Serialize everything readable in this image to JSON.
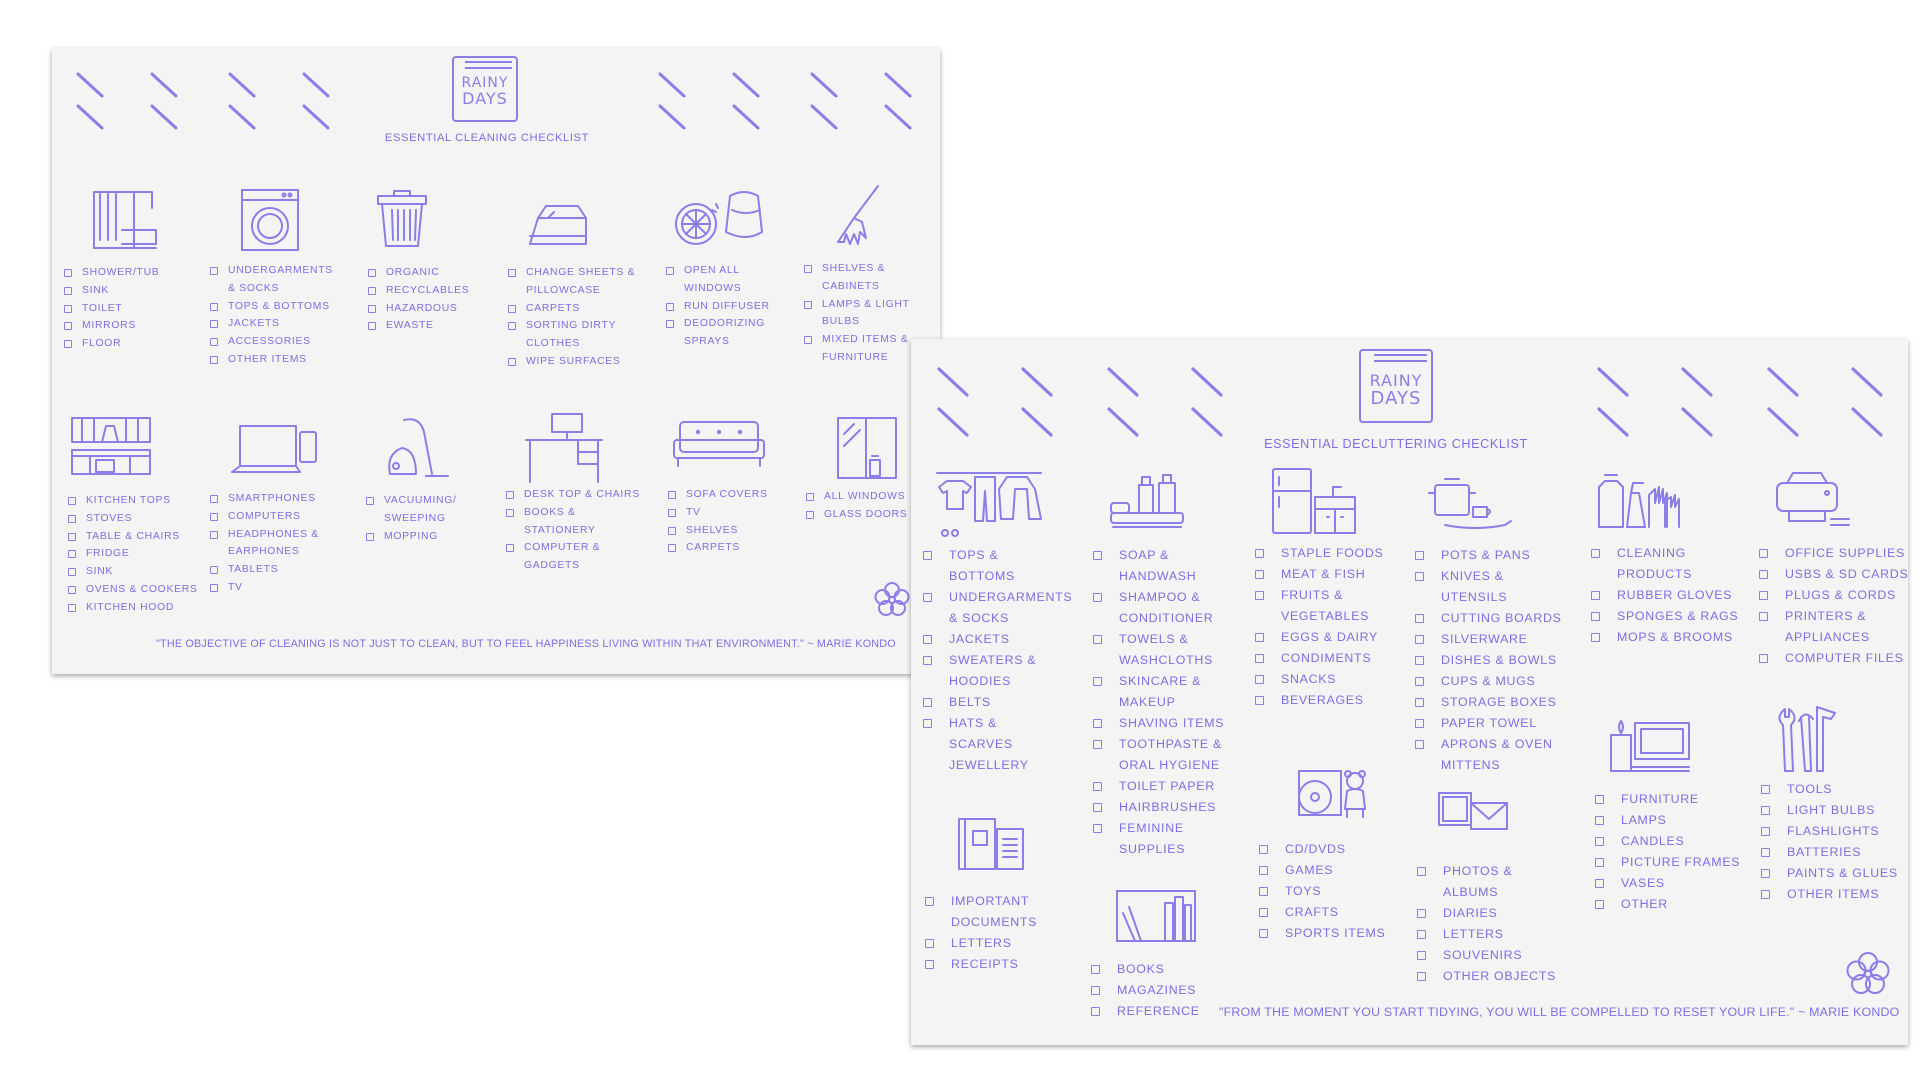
{
  "accent": "#7b6fe3",
  "logo": {
    "line1": "RAINY",
    "line2": "DAYS"
  },
  "cleaning": {
    "title": "ESSENTIAL CLEANING CHECKLIST",
    "groups": [
      {
        "icon": "shower-icon",
        "items": [
          "SHOWER/TUB",
          "SINK",
          "TOILET",
          "MIRRORS",
          "FLOOR"
        ]
      },
      {
        "icon": "washing-machine-icon",
        "items": [
          "UNDERGARMENTS",
          "& SOCKS",
          "TOPS & BOTTOMS",
          "JACKETS",
          "ACCESSORIES",
          "OTHER ITEMS"
        ]
      },
      {
        "icon": "trash-bin-icon",
        "items": [
          "ORGANIC",
          "RECYCLABLES",
          "HAZARDOUS",
          "EWASTE"
        ]
      },
      {
        "icon": "iron-icon",
        "items": [
          "CHANGE SHEETS &",
          "PILLOWCASE",
          "CARPETS",
          "SORTING DIRTY",
          "CLOTHES",
          "WIPE SURFACES"
        ]
      },
      {
        "icon": "diffuser-icon",
        "items": [
          "OPEN ALL",
          "WINDOWS",
          "RUN DIFFUSER",
          "DEODORIZING",
          "SPRAYS"
        ]
      },
      {
        "icon": "duster-icon",
        "items": [
          "SHELVES &",
          "CABINETS",
          "LAMPS & LIGHT",
          "BULBS",
          "MIXED ITEMS &",
          "FURNITURE"
        ]
      },
      {
        "icon": "kitchen-icon",
        "items": [
          "KITCHEN TOPS",
          "STOVES",
          "TABLE & CHAIRS",
          "FRIDGE",
          "SINK",
          "OVENS & COOKERS",
          "KITCHEN HOOD"
        ]
      },
      {
        "icon": "laptop-phone-icon",
        "items": [
          "SMARTPHONES",
          "COMPUTERS",
          "HEADPHONES &",
          "EARPHONES",
          "TABLETS",
          "TV"
        ]
      },
      {
        "icon": "vacuum-icon",
        "items": [
          "VACUUMING/",
          "SWEEPING",
          "MOPPING"
        ]
      },
      {
        "icon": "desk-icon",
        "items": [
          "DESK TOP & CHAIRS",
          "BOOKS &",
          "STATIONERY",
          "COMPUTER &",
          "GADGETS"
        ]
      },
      {
        "icon": "sofa-icon",
        "items": [
          "SOFA COVERS",
          "TV",
          "SHELVES",
          "CARPETS"
        ]
      },
      {
        "icon": "window-icon",
        "items": [
          "ALL WINDOWS",
          "GLASS DOORS"
        ]
      }
    ],
    "quote": "\"THE OBJECTIVE OF CLEANING IS NOT JUST TO CLEAN, BUT TO FEEL HAPPINESS LIVING WITHIN THAT ENVIRONMENT.\"  ~ MARIE KONDO"
  },
  "decluttering": {
    "title": "ESSENTIAL DECLUTTERING CHECKLIST",
    "groups": [
      {
        "icon": "clothes-rack-icon",
        "items": [
          "TOPS & BOTTOMS",
          "UNDERGARMENTS",
          "& SOCKS",
          "JACKETS",
          "SWEATERS &",
          "HOODIES",
          "BELTS",
          "HATS & SCARVES",
          "JEWELLERY"
        ]
      },
      {
        "icon": "toiletries-icon",
        "items": [
          "SOAP &",
          "HANDWASH",
          "SHAMPOO &",
          "CONDITIONER",
          "TOWELS &",
          "WASHCLOTHS",
          "SKINCARE &",
          "MAKEUP",
          "SHAVING ITEMS",
          "TOOTHPASTE &",
          "ORAL HYGIENE",
          "TOILET PAPER",
          "HAIRBRUSHES",
          "FEMININE",
          "SUPPLIES"
        ]
      },
      {
        "icon": "fridge-icon",
        "items": [
          "STAPLE FOODS",
          "MEAT & FISH",
          "FRUITS &",
          "VEGETABLES",
          "EGGS & DAIRY",
          "CONDIMENTS",
          "SNACKS",
          "BEVERAGES"
        ]
      },
      {
        "icon": "cookware-icon",
        "items": [
          "POTS & PANS",
          "KNIVES & UTENSILS",
          "CUTTING BOARDS",
          "SILVERWARE",
          "DISHES & BOWLS",
          "CUPS & MUGS",
          "STORAGE BOXES",
          "PAPER TOWEL",
          "APRONS & OVEN",
          "MITTENS"
        ]
      },
      {
        "icon": "cleaning-products-icon",
        "items": [
          "CLEANING",
          "PRODUCTS",
          "RUBBER GLOVES",
          "SPONGES & RAGS",
          "MOPS & BROOMS"
        ]
      },
      {
        "icon": "printer-icon",
        "items": [
          "OFFICE SUPPLIES",
          "USBS & SD CARDS",
          "PLUGS & CORDS",
          "PRINTERS &",
          "APPLIANCES",
          "COMPUTER FILES"
        ]
      },
      {
        "icon": "cd-teddy-icon",
        "items": [
          "CD/DVDS",
          "GAMES",
          "TOYS",
          "CRAFTS",
          "SPORTS ITEMS"
        ]
      },
      {
        "icon": "photo-envelope-icon",
        "items": [
          "PHOTOS & ALBUMS",
          "DIARIES",
          "LETTERS",
          "SOUVENIRS",
          "OTHER OBJECTS"
        ]
      },
      {
        "icon": "candle-frame-icon",
        "items": [
          "FURNITURE",
          "LAMPS",
          "CANDLES",
          "PICTURE FRAMES",
          "VASES",
          "OTHER"
        ]
      },
      {
        "icon": "tools-icon",
        "items": [
          "TOOLS",
          "LIGHT BULBS",
          "FLASHLIGHTS",
          "BATTERIES",
          "PAINTS & GLUES",
          "OTHER ITEMS"
        ]
      },
      {
        "icon": "documents-icon",
        "items": [
          "IMPORTANT",
          "DOCUMENTS",
          "LETTERS",
          "RECEIPTS"
        ]
      },
      {
        "icon": "bookshelf-icon",
        "items": [
          "BOOKS",
          "MAGAZINES",
          "REFERENCE"
        ]
      }
    ],
    "quote": "\"FROM THE MOMENT YOU START TIDYING, YOU WILL BE COMPELLED TO RESET YOUR LIFE.\"  ~ MARIE KONDO"
  }
}
